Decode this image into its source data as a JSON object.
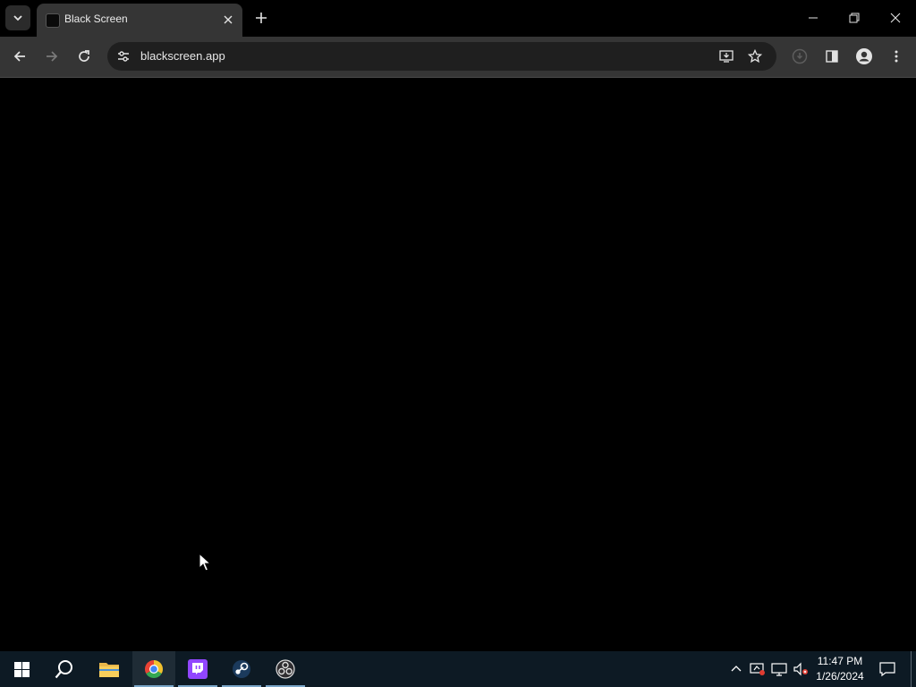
{
  "browser": {
    "tab": {
      "title": "Black Screen",
      "favicon": "black-square-favicon"
    },
    "address": {
      "url": "blackscreen.app"
    },
    "icons": {
      "tab_search": "chevron-down-icon",
      "tab_close": "close-icon",
      "new_tab": "plus-icon",
      "back": "arrow-left-icon",
      "forward": "arrow-right-icon",
      "reload": "reload-icon",
      "site_info": "tune-icon",
      "install": "install-app-icon",
      "bookmark": "star-icon",
      "extensions": "extension-icon",
      "side_panel": "side-panel-icon",
      "profile": "profile-icon",
      "menu": "kebab-menu-icon"
    },
    "colors": {
      "frame": "#000000",
      "toolbar": "#353535",
      "omnibox": "#1f1f1f",
      "page": "#000000"
    }
  },
  "window_controls": [
    "minimize",
    "restore",
    "close"
  ],
  "taskbar": {
    "apps": [
      {
        "name": "start",
        "icon": "windows-logo-icon"
      },
      {
        "name": "search",
        "icon": "search-icon"
      },
      {
        "name": "file-explorer",
        "icon": "folder-icon"
      },
      {
        "name": "chrome",
        "icon": "chrome-icon",
        "active": true
      },
      {
        "name": "twitch",
        "icon": "twitch-icon"
      },
      {
        "name": "steam",
        "icon": "steam-icon"
      },
      {
        "name": "obs",
        "icon": "obs-icon"
      }
    ],
    "tray_icons": [
      "chevron-up-icon",
      "device-icon",
      "network-icon",
      "volume-muted-icon"
    ],
    "clock": {
      "time": "11:47 PM",
      "date": "1/26/2024"
    },
    "colors": {
      "background": "#0d1a24",
      "accent": "#7aa6c8"
    }
  }
}
